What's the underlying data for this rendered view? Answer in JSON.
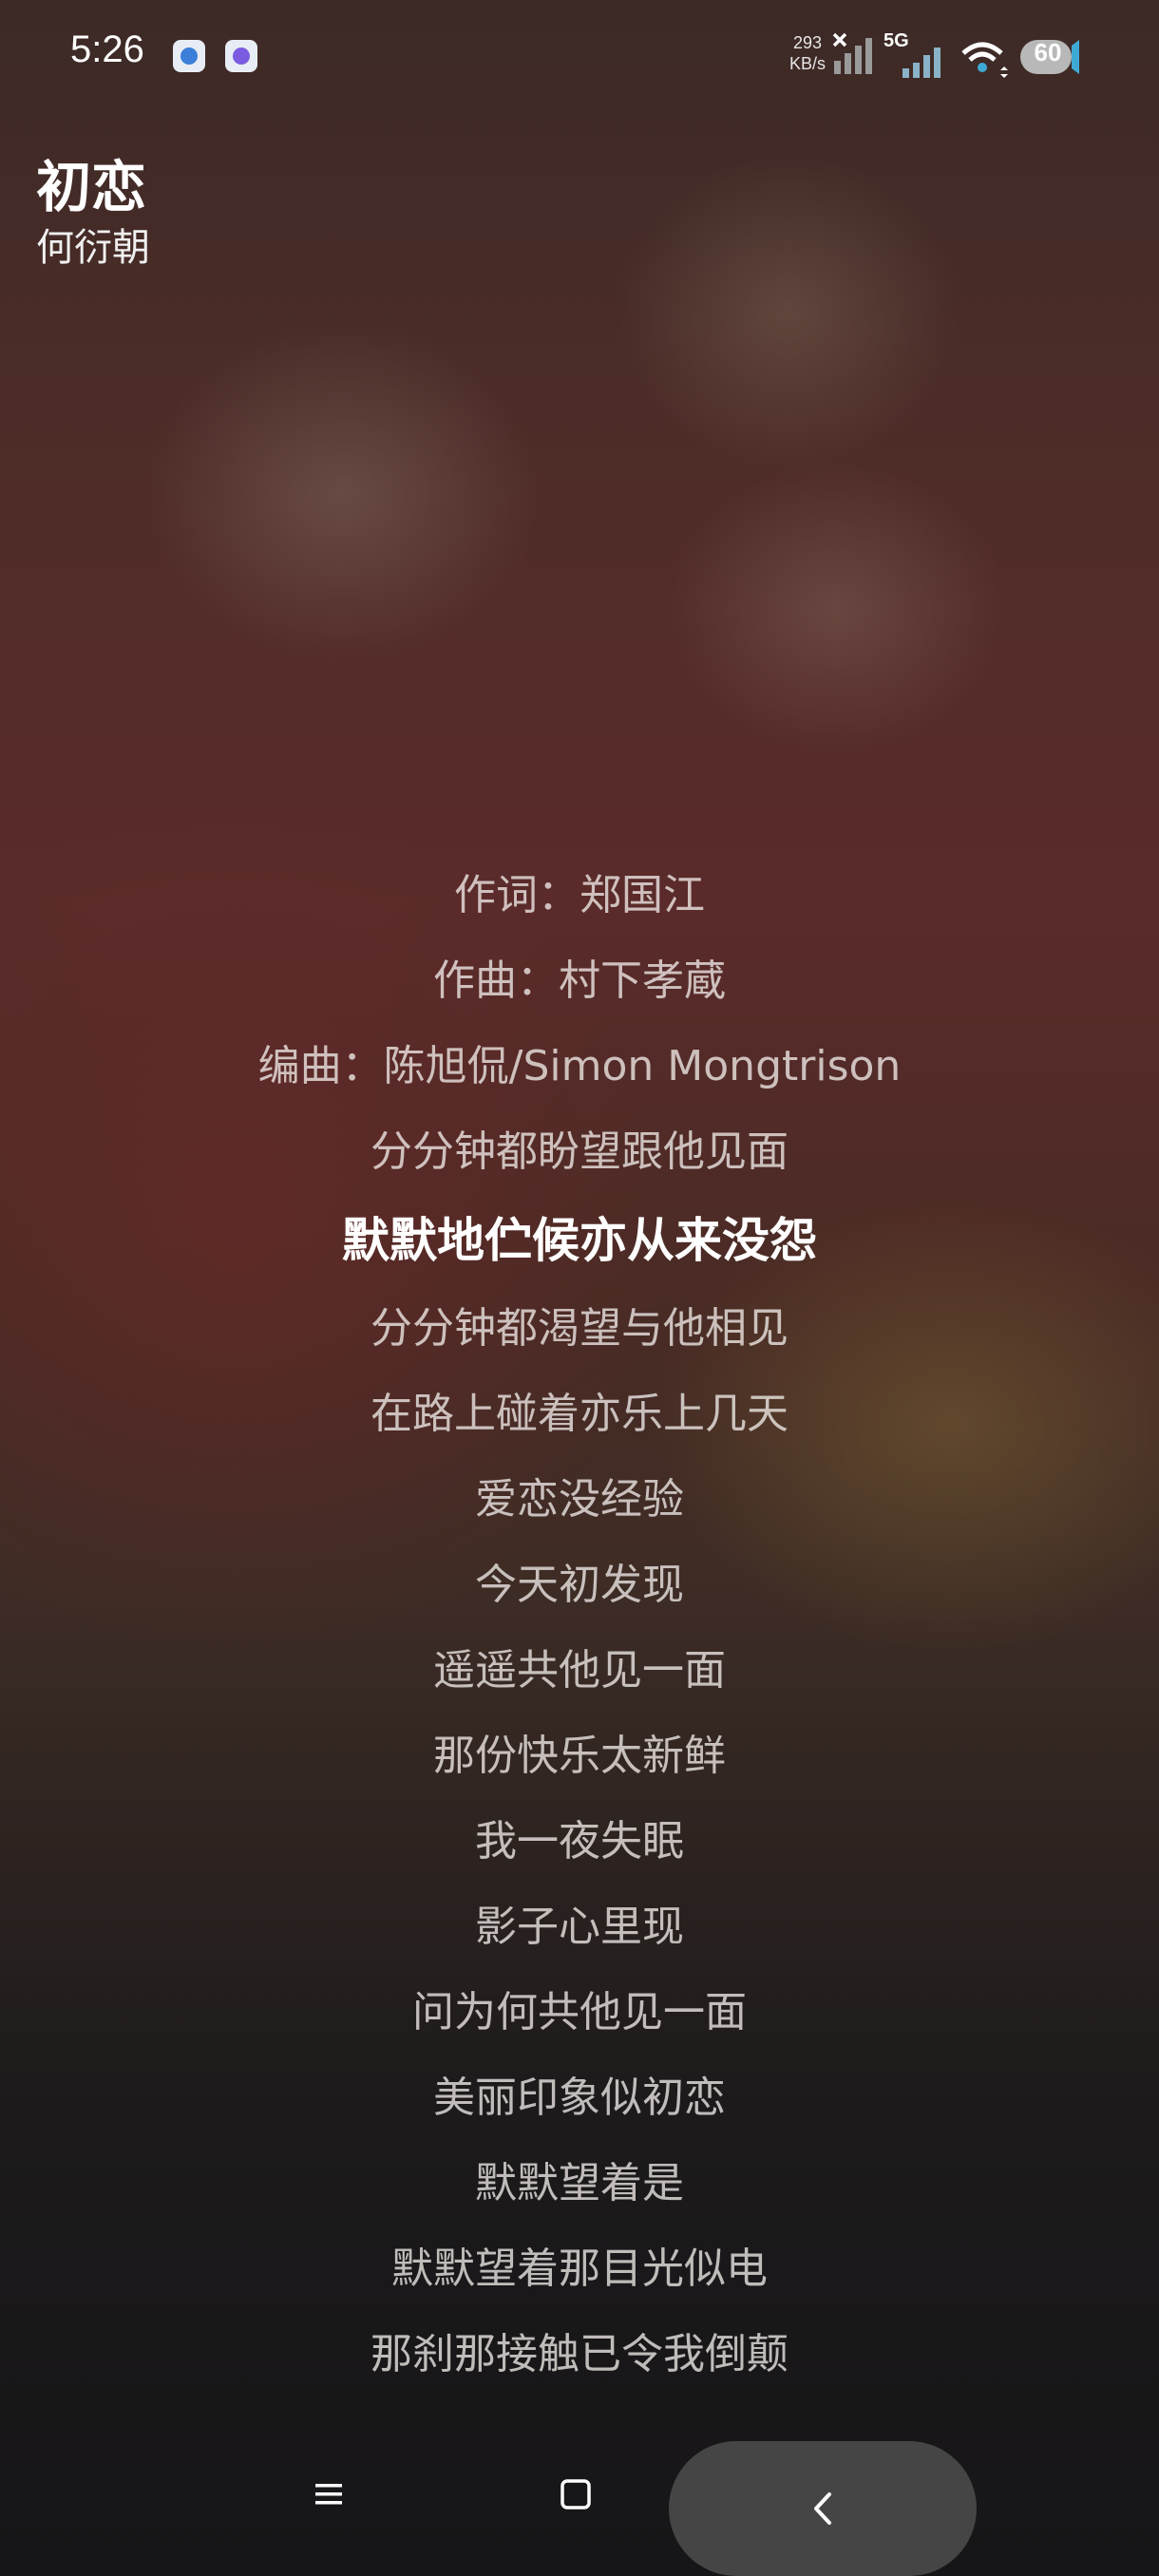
{
  "status_bar": {
    "time": "5:26",
    "net_speed_value": "293",
    "net_speed_unit": "KB/s",
    "network_type": "5G",
    "battery_level": "60",
    "icons": [
      "notification-app-icon",
      "notification-app-icon-2",
      "signal-disabled-icon",
      "signal-5g-icon",
      "wifi-icon",
      "battery-icon"
    ]
  },
  "song": {
    "title": "初恋",
    "artist": "何衍朝"
  },
  "lyrics": {
    "active_index": 4,
    "lines": [
      "作词：郑国江",
      "作曲：村下孝蔵",
      "编曲：陈旭侃/Simon Mongtrison",
      "分分钟都盼望跟他见面",
      "默默地伫候亦从来没怨",
      "分分钟都渴望与他相见",
      "在路上碰着亦乐上几天",
      "爱恋没经验",
      "今天初发现",
      "遥遥共他见一面",
      "那份快乐太新鲜",
      "我一夜失眠",
      "影子心里现",
      "问为何共他见一面",
      "美丽印象似初恋",
      "默默望着是",
      "默默望着那目光似电",
      "那刹那接触已令我倒颠"
    ]
  },
  "nav_bar": {
    "icons": [
      "menu-icon",
      "home-icon",
      "back-icon"
    ]
  }
}
